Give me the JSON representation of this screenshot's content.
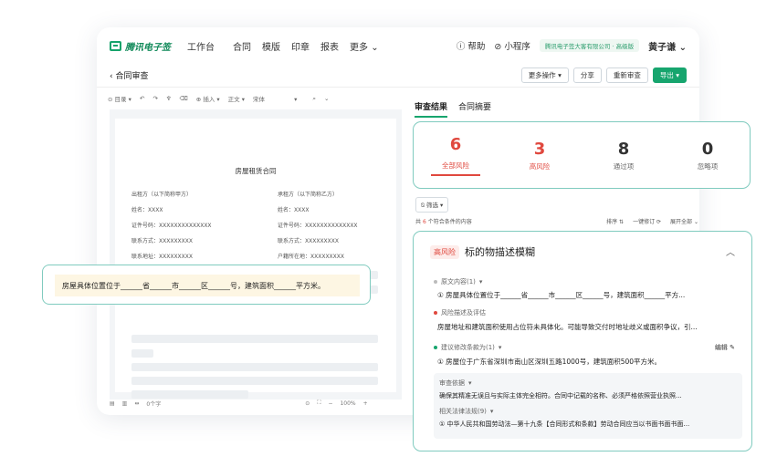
{
  "app": {
    "logo": "腾讯电子签"
  },
  "nav": {
    "items": [
      "工作台",
      "合同",
      "模版",
      "印章",
      "报表",
      "更多"
    ],
    "help": "帮助",
    "mini": "小程序",
    "company": "腾讯电子签大客有限公司 · 高级版",
    "user": "黄子谦"
  },
  "sub": {
    "back": "合同审查",
    "more_actions": "更多操作",
    "share": "分享",
    "recheck": "重新审查",
    "export": "导出"
  },
  "editor": {
    "tools": [
      "目录",
      "插入",
      "正文",
      "宋体"
    ],
    "zoom": "100%",
    "wordcount": "0个字"
  },
  "doc": {
    "title": "房屋租赁合同",
    "left": [
      "出租方（以下简称甲方）",
      "姓名：XXXX",
      "证件号码：XXXXXXXXXXXXXX",
      "联系方式：XXXXXXXXX",
      "联系地址：XXXXXXXXX"
    ],
    "right": [
      "承租方（以下简称乙方）",
      "姓名：XXXX",
      "证件号码：XXXXXXXXXXXXXX",
      "联系方式：XXXXXXXXX",
      "户籍所在地：XXXXXXXXX"
    ]
  },
  "highlight": "房屋具体位置位于______省______市______区______号，建筑面积______平方米。",
  "tabs": {
    "result": "审查结果",
    "summary": "合同摘要"
  },
  "stats": [
    {
      "num": "6",
      "label": "全部风险"
    },
    {
      "num": "3",
      "label": "高风险"
    },
    {
      "num": "8",
      "label": "通过项"
    },
    {
      "num": "0",
      "label": "忽略项"
    }
  ],
  "filter": "筛选",
  "meta": {
    "prefix": "共",
    "count": "6",
    "suffix": "个符合条件的内容",
    "sort": "排序",
    "fix": "一键修订",
    "expand": "展开全部"
  },
  "card": {
    "tag": "高风险",
    "title": "标的物描述模糊",
    "orig_label": "原文内容(1)",
    "orig": "① 房屋具体位置位于______省______市______区______号，建筑面积______平方...",
    "risk_label": "风险描述及评估",
    "risk": "房屋地址和建筑面积使用占位符未具体化。可能导致交付时地址歧义或面积争议，引...",
    "advice_label": "建议修改条款为(1)",
    "advice": "① 房屋位于广东省深圳市南山区深圳五路1000号，建筑面积500平方米。",
    "edit": "编辑",
    "basis_label": "审查依据",
    "basis": "确保其精准无误且与实际主体完全相符。合同中记载的名称、必须严格依照营业执照...",
    "law_label": "相关法律法规(9)",
    "law": "① 中华人民共和国劳动法—第十九条【合同形式和条款】劳动合同应当以书面书面书面..."
  }
}
